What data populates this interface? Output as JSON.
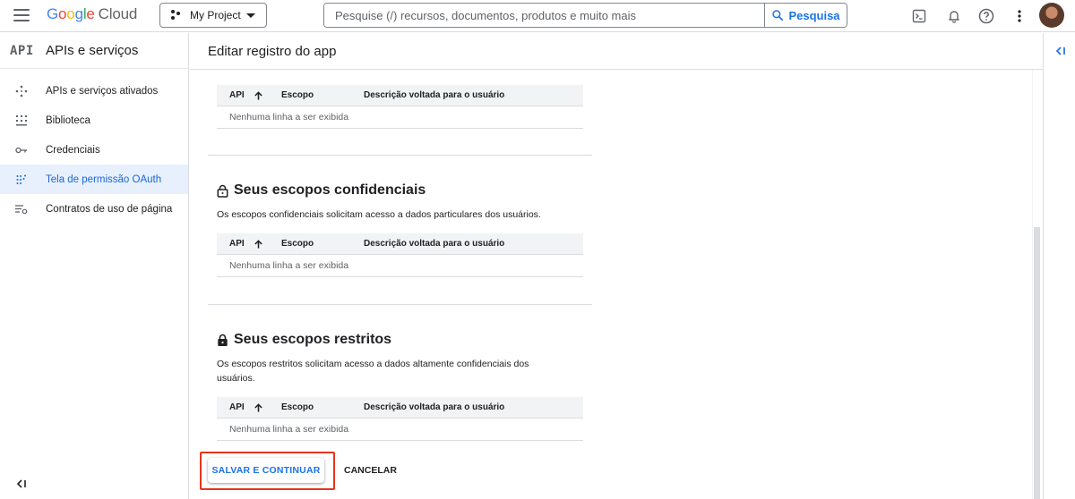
{
  "topbar": {
    "logo_letters": [
      "G",
      "o",
      "o",
      "g",
      "l",
      "e"
    ],
    "logo_suffix": "Cloud",
    "project_name": "My Project",
    "search": {
      "placeholder": "Pesquise (/) recursos, documentos, produtos e muito mais",
      "button_label": "Pesquisa"
    },
    "icons": [
      "terminal-icon",
      "bell-icon",
      "help-icon",
      "more-vert-icon"
    ],
    "colors": {
      "blue": "#4285f4",
      "red": "#ea4335",
      "yellow": "#fbbc05",
      "green": "#34a853"
    }
  },
  "sidebar": {
    "mark": "API",
    "title": "APIs e serviços",
    "items": [
      {
        "label": "APIs e serviços ativados",
        "icon": "apis-diamond-icon",
        "active": false
      },
      {
        "label": "Biblioteca",
        "icon": "library-grid-icon",
        "active": false
      },
      {
        "label": "Credenciais",
        "icon": "key-icon",
        "active": false
      },
      {
        "label": "Tela de permissão OAuth",
        "icon": "oauth-dots-icon",
        "active": true
      },
      {
        "label": "Contratos de uso de página",
        "icon": "page-settings-icon",
        "active": false
      }
    ],
    "active_color": "#1967d2"
  },
  "main": {
    "header_title": "Editar registro do app",
    "tables": {
      "col_api": "API",
      "col_scope": "Escopo",
      "col_desc": "Descrição voltada para o usuário",
      "empty_text": "Nenhuma linha a ser exibida"
    },
    "sections": {
      "sensitive": {
        "title": "Seus escopos confidenciais",
        "description": "Os escopos confidenciais solicitam acesso a dados particulares dos usuários."
      },
      "restricted": {
        "title": "Seus escopos restritos",
        "description": "Os escopos restritos solicitam acesso a dados altamente confidenciais dos usuários."
      }
    },
    "actions": {
      "save_label": "SALVAR E CONTINUAR",
      "cancel_label": "CANCELAR",
      "highlight_color": "#e8341c"
    }
  }
}
